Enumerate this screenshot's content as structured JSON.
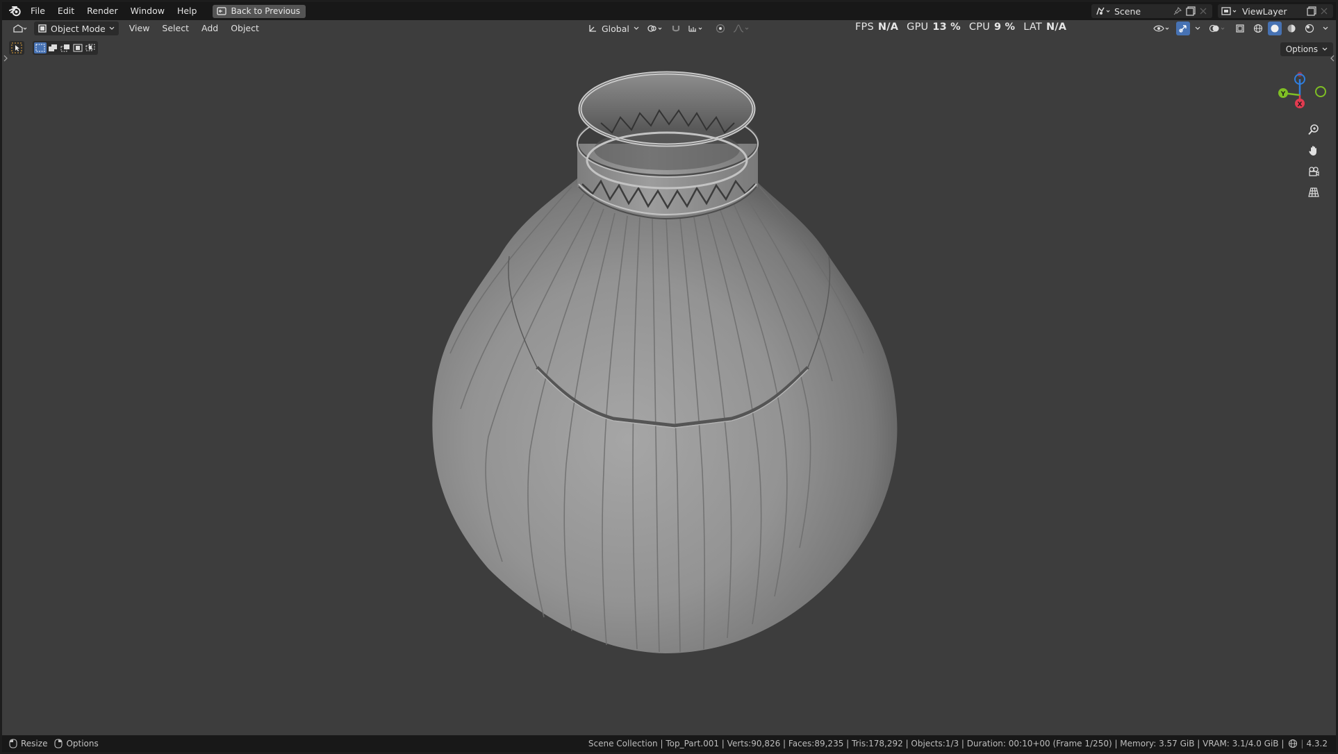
{
  "menu": {
    "items": [
      "File",
      "Edit",
      "Render",
      "Window",
      "Help"
    ],
    "back_button": "Back to Previous"
  },
  "scene": {
    "label": "Scene"
  },
  "view_layer": {
    "label": "ViewLayer"
  },
  "viewport_header": {
    "mode": "Object Mode",
    "menus": [
      "View",
      "Select",
      "Add",
      "Object"
    ],
    "transform_orientation": "Global",
    "options_label": "Options"
  },
  "stats": {
    "fps_label": "FPS",
    "fps_value": "N/A",
    "gpu_label": "GPU",
    "gpu_value": "13 %",
    "cpu_label": "CPU",
    "cpu_value": "9 %",
    "lat_label": "LAT",
    "lat_value": "N/A"
  },
  "gizmo": {
    "y_label": "Y",
    "x_label": "X"
  },
  "statusbar": {
    "left_action1": "Resize",
    "left_action2": "Options",
    "info": "Scene Collection | Top_Part.001 | Verts:90,826 | Faces:89,235 | Tris:178,292 | Objects:1/3 | Duration: 00:10+00 (Frame 1/250) | Memory: 3.57 GiB | VRAM: 3.1/4.0 GiB |",
    "version": "4.3.2"
  },
  "colors": {
    "viewport_bg": "#3d3d3d",
    "bar_bg": "#181818",
    "axis_x": "#e23b50",
    "axis_y": "#7fbf24",
    "axis_z": "#2f7fe0",
    "selected_blue": "#4772b3"
  }
}
